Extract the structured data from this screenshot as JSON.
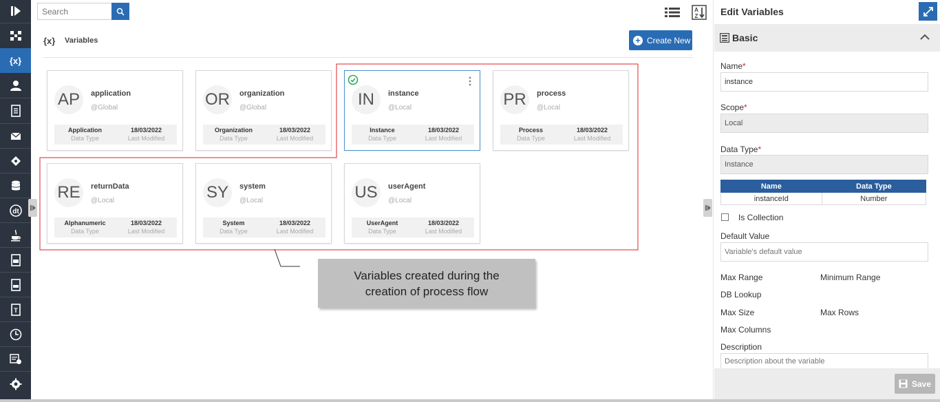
{
  "rail": {
    "items": [
      {
        "icon": "logo-play-icon"
      },
      {
        "icon": "hierarchy-icon"
      },
      {
        "icon": "variables-icon",
        "label": "{x}",
        "active": true
      },
      {
        "icon": "user-icon"
      },
      {
        "icon": "document-icon"
      },
      {
        "icon": "mail-icon"
      },
      {
        "icon": "diamond-icon"
      },
      {
        "icon": "database-icon"
      },
      {
        "icon": "dt-icon",
        "label": "dt"
      },
      {
        "icon": "java-icon"
      },
      {
        "icon": "js-file-icon"
      },
      {
        "icon": "css-file-icon"
      },
      {
        "icon": "text-file-icon",
        "label": "T"
      },
      {
        "icon": "clock-icon"
      },
      {
        "icon": "report-icon"
      },
      {
        "icon": "settings-icon"
      }
    ]
  },
  "search": {
    "placeholder": "Search"
  },
  "header": {
    "icon_label": "{x}",
    "title": "Variables",
    "create_label": "Create New"
  },
  "cards": [
    {
      "initials": "AP",
      "name": "application",
      "scope": "@Global",
      "type": "Application",
      "date": "18/03/2022",
      "type_label": "Data Type",
      "date_label": "Last Modified"
    },
    {
      "initials": "OR",
      "name": "organization",
      "scope": "@Global",
      "type": "Organization",
      "date": "18/03/2022",
      "type_label": "Data Type",
      "date_label": "Last Modified"
    },
    {
      "initials": "IN",
      "name": "instance",
      "scope": "@Local",
      "type": "Instance",
      "date": "18/03/2022",
      "type_label": "Data Type",
      "date_label": "Last Modified",
      "selected": true
    },
    {
      "initials": "PR",
      "name": "process",
      "scope": "@Local",
      "type": "Process",
      "date": "18/03/2022",
      "type_label": "Data Type",
      "date_label": "Last Modified"
    },
    {
      "initials": "RE",
      "name": "returnData",
      "scope": "@Local",
      "type": "Alphanumeric",
      "date": "18/03/2022",
      "type_label": "Data Type",
      "date_label": "Last Modified"
    },
    {
      "initials": "SY",
      "name": "system",
      "scope": "@Local",
      "type": "System",
      "date": "18/03/2022",
      "type_label": "Data Type",
      "date_label": "Last Modified"
    },
    {
      "initials": "US",
      "name": "userAgent",
      "scope": "@Local",
      "type": "UserAgent",
      "date": "18/03/2022",
      "type_label": "Data Type",
      "date_label": "Last Modified"
    }
  ],
  "callout": {
    "line1": "Variables created during the",
    "line2": "creation of process flow"
  },
  "panel": {
    "title": "Edit Variables",
    "section": "Basic",
    "name_label": "Name",
    "name_value": "instance",
    "scope_label": "Scope",
    "scope_value": "Local",
    "datatype_label": "Data Type",
    "datatype_value": "Instance",
    "required_mark": "*",
    "table": {
      "headers": [
        "Name",
        "Data Type"
      ],
      "rows": [
        [
          "instanceId",
          "Number"
        ]
      ]
    },
    "is_collection_label": "Is Collection",
    "is_collection_checked": false,
    "default_label": "Default Value",
    "default_placeholder": "Variable's default value",
    "max_range_label": "Max Range",
    "min_range_label": "Minimum Range",
    "db_lookup_label": "DB Lookup",
    "max_size_label": "Max Size",
    "max_rows_label": "Max Rows",
    "max_columns_label": "Max Columns",
    "description_label": "Description",
    "description_placeholder": "Description about the variable",
    "save_label": "Save"
  },
  "colors": {
    "accent": "#2a6cb3",
    "rail_bg": "#2c3440",
    "highlight": "#d9242a",
    "check": "#2eaa5c"
  }
}
